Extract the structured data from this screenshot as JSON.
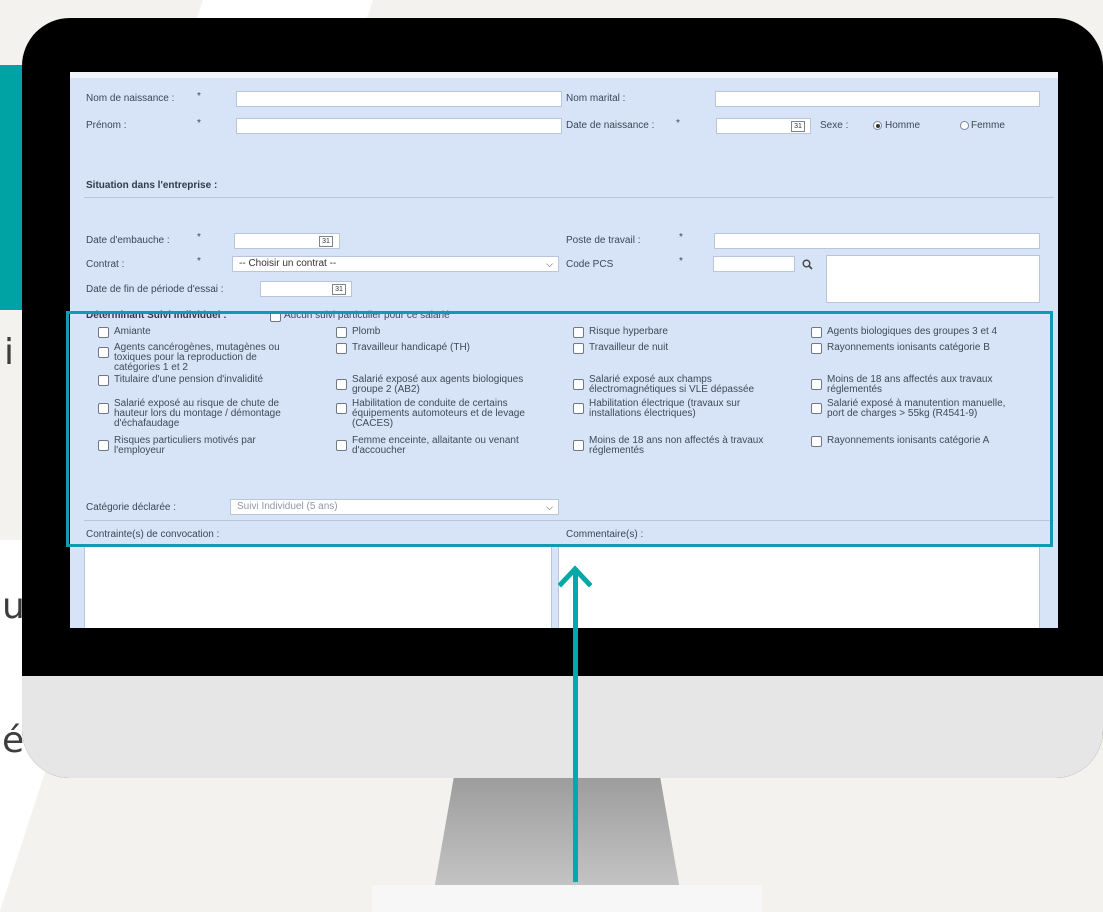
{
  "form": {
    "nom_naissance": {
      "label": "Nom de naissance :",
      "required": "*",
      "value": ""
    },
    "nom_marital": {
      "label": "Nom marital :",
      "value": ""
    },
    "prenom": {
      "label": "Prénom :",
      "required": "*",
      "value": ""
    },
    "date_naissance": {
      "label": "Date de naissance :",
      "required": "*",
      "value": "",
      "calendar_icon": "31"
    },
    "sexe": {
      "label": "Sexe :",
      "options": [
        "Homme",
        "Femme"
      ],
      "selected": "Homme"
    },
    "situation_title": "Situation dans l'entreprise :",
    "date_embauche": {
      "label": "Date d'embauche :",
      "required": "*",
      "calendar_icon": "31"
    },
    "poste_travail": {
      "label": "Poste de travail :",
      "required": "*"
    },
    "contrat": {
      "label": "Contrat :",
      "required": "*",
      "selected": "-- Choisir un contrat --"
    },
    "code_pcs": {
      "label": "Code PCS",
      "required": "*"
    },
    "date_fin_essai": {
      "label": "Date de fin de période d'essai :",
      "calendar_icon": "31"
    },
    "suivi": {
      "title": "Déterminant Suivi Individuel :",
      "none_label": "Aucun suivi particulier pour ce salarié",
      "columns": [
        [
          {
            "text": "Amiante",
            "lines": [
              "Amiante"
            ]
          },
          {
            "text": "Agents cancérogènes, mutagènes ou toxiques pour la reproduction de catégories 1 et 2",
            "lines": [
              "Agents cancérogènes, mutagènes ou",
              "toxiques pour la reproduction de",
              "catégories 1 et 2"
            ]
          },
          {
            "text": "Titulaire d'une pension d'invalidité",
            "lines": [
              "Titulaire d'une pension d'invalidité"
            ]
          },
          {
            "text": "Salarié exposé au risque de chute de hauteur lors du montage / démontage d'échafaudage",
            "lines": [
              "Salarié exposé au risque de chute de",
              "hauteur lors du montage / démontage",
              "d'échafaudage"
            ]
          },
          {
            "text": "Risques particuliers motivés par l'employeur",
            "lines": [
              "Risques particuliers motivés par",
              "l'employeur"
            ]
          }
        ],
        [
          {
            "text": "Plomb",
            "lines": [
              "Plomb"
            ]
          },
          {
            "text": "Travailleur handicapé (TH)",
            "lines": [
              "Travailleur handicapé (TH)"
            ]
          },
          {
            "text": "Salarié exposé aux agents biologiques groupe 2 (AB2)",
            "lines": [
              "Salarié exposé aux agents biologiques",
              "groupe 2 (AB2)"
            ]
          },
          {
            "text": "Habilitation de conduite de certains équipements automoteurs et de levage (CACES)",
            "lines": [
              "Habilitation de conduite de certains",
              "équipements automoteurs et de levage",
              "(CACES)"
            ]
          },
          {
            "text": "Femme enceinte, allaitante ou venant d'accoucher",
            "lines": [
              "Femme enceinte, allaitante ou venant",
              "d'accoucher"
            ]
          }
        ],
        [
          {
            "text": "Risque hyperbare",
            "lines": [
              "Risque hyperbare"
            ]
          },
          {
            "text": "Travailleur de nuit",
            "lines": [
              "Travailleur de nuit"
            ]
          },
          {
            "text": "Salarié exposé aux champs électromagnétiques si VLE dépassée",
            "lines": [
              "Salarié exposé aux champs",
              "électromagnétiques si VLE dépassée"
            ]
          },
          {
            "text": "Habilitation électrique (travaux sur installations électriques)",
            "lines": [
              "Habilitation électrique (travaux sur",
              "installations électriques)"
            ]
          },
          {
            "text": "Moins de 18 ans non affectés à travaux réglementés",
            "lines": [
              "Moins de 18 ans non affectés à travaux",
              "réglementés"
            ]
          }
        ],
        [
          {
            "text": "Agents biologiques des groupes 3 et 4",
            "lines": [
              "Agents biologiques des groupes 3 et 4"
            ]
          },
          {
            "text": "Rayonnements ionisants catégorie B",
            "lines": [
              "Rayonnements ionisants catégorie B"
            ]
          },
          {
            "text": "Moins de 18 ans affectés aux travaux réglementés",
            "lines": [
              "Moins de 18 ans affectés aux travaux",
              "réglementés"
            ]
          },
          {
            "text": "Salarié exposé à manutention manuelle, port de charges > 55kg (R4541-9)",
            "lines": [
              "Salarié exposé à manutention manuelle,",
              "port de charges > 55kg (R4541-9)"
            ]
          },
          {
            "text": "Rayonnements ionisants catégorie A",
            "lines": [
              "Rayonnements ionisants catégorie A"
            ]
          }
        ]
      ]
    },
    "categorie": {
      "label": "Catégorie déclarée :",
      "selected": "Suivi Individuel (5 ans)"
    },
    "contraintes_label": "Contrainte(s) de convocation :",
    "commentaires_label": "Commentaire(s) :"
  },
  "background_letters": [
    "i",
    "u",
    "é"
  ],
  "colors": {
    "accent": "#00a3a3",
    "highlight": "#1499b3",
    "form_bg": "#d7e3f6"
  },
  "icons": {
    "search": "search-icon",
    "calendar": "calendar-icon",
    "dropdown": "chevron-down-icon",
    "arrow": "arrow-up-icon"
  }
}
